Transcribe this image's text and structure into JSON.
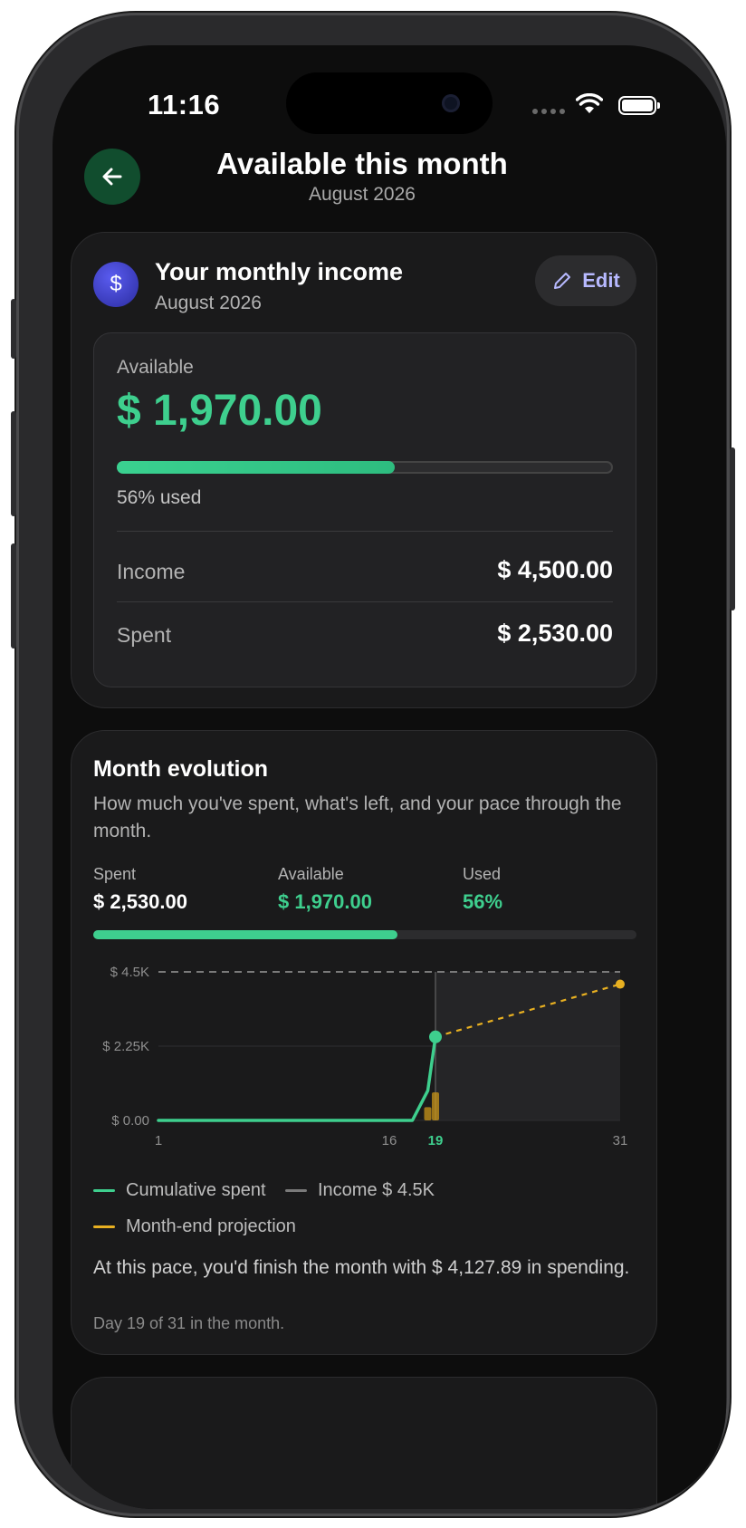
{
  "status": {
    "time": "11:16"
  },
  "header": {
    "title": "Available this month",
    "subtitle": "August 2026"
  },
  "income_card": {
    "title": "Your monthly income",
    "subtitle": "August 2026",
    "edit_label": "Edit",
    "available_label": "Available",
    "available_amount": "$ 1,970.00",
    "used_fraction": 0.56,
    "used_text": "56% used",
    "rows": [
      {
        "label": "Income",
        "value": "$ 4,500.00"
      },
      {
        "label": "Spent",
        "value": "$ 2,530.00"
      }
    ]
  },
  "evolution_card": {
    "title": "Month evolution",
    "description": "How much you've spent, what's left, and your pace through the month.",
    "stats": [
      {
        "label": "Spent",
        "value": "$ 2,530.00",
        "color": "#ffffff"
      },
      {
        "label": "Available",
        "value": "$ 1,970.00",
        "color": "#3ecf8e"
      },
      {
        "label": "Used",
        "value": "56%",
        "color": "#3ecf8e"
      }
    ],
    "used_fraction": 0.56,
    "legend": [
      {
        "label": "Cumulative spent",
        "color": "#3ecf8e"
      },
      {
        "label": "Income $ 4.5K",
        "color": "#7a7a7a"
      },
      {
        "label": "Month-end projection",
        "color": "#e8b021"
      }
    ],
    "pace_text": "At this pace, you'd finish the month with $ 4,127.89 in spending.",
    "day_text": "Day 19 of 31 in the month."
  },
  "chart_data": {
    "type": "line",
    "x_ticks": [
      "1",
      "16",
      "19",
      "31"
    ],
    "highlight_tick": "19",
    "y_ticks": [
      "$ 0.00",
      "$ 2.25K",
      "$ 4.5K"
    ],
    "ylim": [
      0,
      4500
    ],
    "xlim": [
      1,
      31
    ],
    "series": [
      {
        "name": "Cumulative spent",
        "x": [
          1,
          17.5,
          18.5,
          19
        ],
        "y": [
          0,
          0,
          900,
          2530
        ],
        "color": "#3ecf8e"
      },
      {
        "name": "Income $ 4.5K",
        "x": [
          1,
          31
        ],
        "y": [
          4500,
          4500
        ],
        "color": "#7a7a7a"
      },
      {
        "name": "Month-end projection",
        "x": [
          19,
          31
        ],
        "y": [
          2530,
          4127.89
        ],
        "color": "#e8b021"
      }
    ],
    "daily_bars": [
      {
        "x": 18.5,
        "y": 400
      },
      {
        "x": 19,
        "y": 850
      }
    ],
    "colors": {
      "spent": "#3ecf8e",
      "income": "#7a7a7a",
      "projection": "#e8b021"
    }
  }
}
